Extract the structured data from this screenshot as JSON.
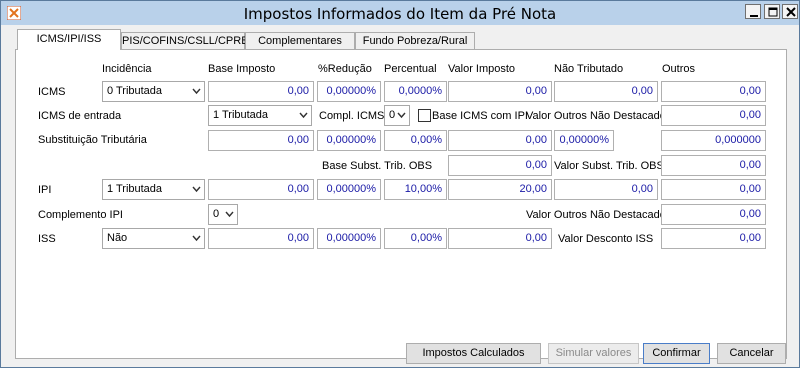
{
  "window": {
    "title": "Impostos Informados do Item da Pré Nota"
  },
  "tabs": [
    {
      "label": "ICMS/IPI/ISS",
      "active": true
    },
    {
      "label": "PIS/COFINS/CSLL/CPRB",
      "active": false
    },
    {
      "label": "Complementares",
      "active": false
    },
    {
      "label": "Fundo Pobreza/Rural",
      "active": false
    }
  ],
  "headers": {
    "incidencia": "Incidência",
    "base_imposto": "Base Imposto",
    "reducao": "%Redução",
    "percentual": "Percentual",
    "valor_imposto": "Valor Imposto",
    "nao_tributado": "Não Tributado",
    "outros": "Outros"
  },
  "icms": {
    "label": "ICMS",
    "incidencia": "0 Tributada",
    "base": "0,00",
    "reducao": "0,00000%",
    "percentual": "0,0000%",
    "valor": "0,00",
    "nao_tributado": "0,00",
    "outros": "0,00"
  },
  "icms_entrada": {
    "label": "ICMS de entrada",
    "tributacao": "1 Tributada",
    "compl_label": "Compl. ICMS",
    "compl_value": "0",
    "base_com_ipi_label": "Base ICMS com IPI",
    "base_com_ipi_checked": false,
    "outros_nao_destacado_label": "Valor Outros Não Destacado",
    "outros_nao_destacado": "0,00"
  },
  "subst": {
    "label": "Substituição Tributária",
    "base": "0,00",
    "reducao": "0,00000%",
    "percentual": "0,00%",
    "valor": "0,00",
    "perc2": "0,00000%",
    "outros": "0,000000"
  },
  "subst_obs": {
    "base_label": "Base Subst. Trib. OBS",
    "base": "0,00",
    "valor_label": "Valor Subst. Trib. OBS",
    "valor": "0,00"
  },
  "ipi": {
    "label": "IPI",
    "incidencia": "1 Tributada",
    "base": "0,00",
    "reducao": "0,00000%",
    "percentual": "10,00%",
    "valor": "20,00",
    "nao_tributado": "0,00",
    "outros": "0,00"
  },
  "compl_ipi": {
    "label": "Complemento IPI",
    "value": "0",
    "outros_nao_destacado_label": "Valor Outros Não Destacado",
    "outros_nao_destacado": "0,00"
  },
  "iss": {
    "label": "ISS",
    "incidencia": "Não",
    "base": "0,00",
    "reducao": "0,00000%",
    "percentual": "0,00%",
    "valor": "0,00",
    "desconto_label": "Valor Desconto ISS",
    "desconto": "0,00"
  },
  "buttons": {
    "impostos_calculados": "Impostos Calculados",
    "simular": "Simular valores",
    "confirmar": "Confirmar",
    "cancelar": "Cancelar"
  },
  "colors": {
    "value_text": "#1a1aa6",
    "titlebar": "#b9d1ea"
  }
}
